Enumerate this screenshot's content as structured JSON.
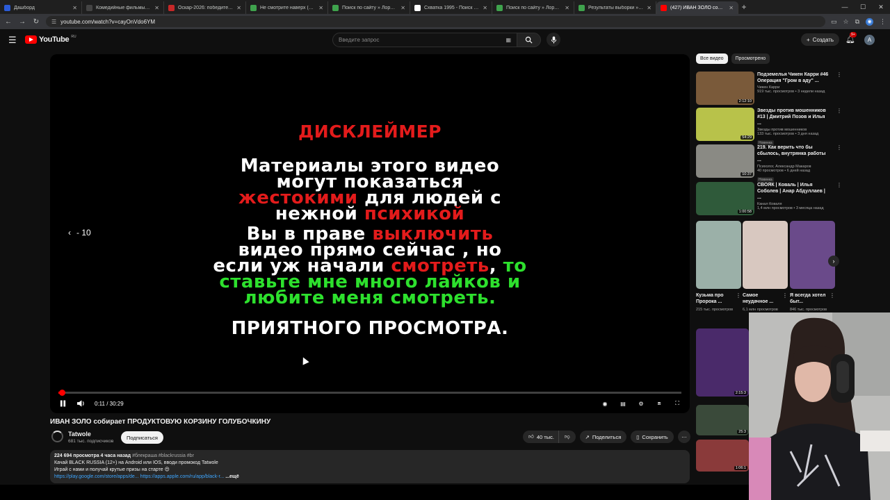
{
  "browser": {
    "tabs": [
      {
        "title": "Дашборд",
        "color": "#2b5bd7",
        "active": false
      },
      {
        "title": "Комедийные фильмы, которые...",
        "color": "#444",
        "active": false
      },
      {
        "title": "Оскар-2026: победители и но...",
        "color": "#c62828",
        "active": false
      },
      {
        "title": "Не смотрите наверх (2021) сл...",
        "color": "#3fa34d",
        "active": false
      },
      {
        "title": "Поиск по сайту » Лордфильм",
        "color": "#3fa34d",
        "active": false
      },
      {
        "title": "Схватка 1995 - Поиск в Google",
        "color": "#ffffff",
        "active": false
      },
      {
        "title": "Поиск по сайту » Лордфильм",
        "color": "#3fa34d",
        "active": false
      },
      {
        "title": "Результаты выборки » Лордф...",
        "color": "#3fa34d",
        "active": false
      },
      {
        "title": "(427) ИВАН ЗОЛО собир...",
        "color": "#ff0000",
        "active": true
      }
    ],
    "new_tab": "+",
    "url": "youtube.com/watch?v=cayOnVdo6YM"
  },
  "masthead": {
    "logo": "YouTube",
    "region": "RU",
    "search_placeholder": "Введите запрос",
    "create_label": "Создать",
    "notifications_badge": "9+",
    "avatar_letter": "A"
  },
  "video": {
    "disclaimer": {
      "heading": "ДИСКЛЕЙМЕР",
      "line1": "Материалы этого видео",
      "line2": "могут показаться",
      "line3_red": "жестокими",
      "line3_white": " для людей с",
      "line4_white": "нежной ",
      "line4_red": "психикой",
      "line5_white": "Вы в праве ",
      "line5_red": "выключить",
      "line6": "видео прямо сейчас , но",
      "line7_white": "если уж начали ",
      "line7_red": "смотреть",
      "line7_white2": ",",
      "line7_green": " то",
      "line8": "ставьте мне много лайков и",
      "line9": "любите меня смотреть.",
      "line10": "ПРИЯТНОГО ПРОСМОТРА."
    },
    "seek_back": "- 10",
    "time": "0:11 / 30:29",
    "progress_fraction": 0.006,
    "title": "ИВАН ЗОЛО собирает ПРОДУКТОВУЮ КОРЗИНУ ГОЛУБОЧКИНУ",
    "channel": {
      "name": "Tatwole",
      "subs": "681 тыс. подписчиков",
      "subscribe": "Подписаться"
    },
    "actions": {
      "likes": "40 тыс.",
      "share": "Поделиться",
      "save": "Сохранить"
    },
    "description": {
      "meta": "224 694 просмотра  4 часа назад",
      "tags": "#блекраша #blackrussia #br",
      "line1": "Качай BLACK RUSSIA (12+) на Android или IOS, вводи промокод Tatwole",
      "line2": "Играй с нами и получай крутые призы на старте 😍",
      "link1": "https://play.google.com/store/apps/de...",
      "link2": "https://apps.apple.com/ru/app/black-r...",
      "more": "...ещё"
    }
  },
  "sidebar": {
    "chips": [
      "Все видео",
      "Просмотрено"
    ],
    "recommendations": [
      {
        "title": "Подземелья Чикен Карри #46 Операция \"Гром в аду\" ...",
        "channel": "Чикен Карри",
        "meta": "919 тыс. просмотров • 3 недели назад",
        "duration": "2:12:10",
        "badge": "",
        "color": "#7a5a3a"
      },
      {
        "title": "Звезды против мошенников #13 | Дмитрий Позов и Илья ...",
        "channel": "Звезды против мошенников",
        "meta": "133 тыс. просмотров • 3 дня назад",
        "duration": "54:29",
        "badge": "Новинка",
        "color": "#b8c24a"
      },
      {
        "title": "219. Как верить что бы сбылось, внутрянка работы ...",
        "channel": "Психолог, Александр Макаров",
        "meta": "40 просмотров • 6 дней назад",
        "duration": "10:37",
        "badge": "Новинка",
        "color": "#8a8a84"
      },
      {
        "title": "СВОЯК | Коваль | Илья Соболев | Анар Абдуллаев | ...",
        "channel": "Канал Коваля",
        "meta": "1,4 млн просмотров • 3 месяца назад",
        "duration": "1:00:58",
        "badge": "",
        "color": "#2f5a3a"
      }
    ],
    "shorts": [
      {
        "title": "Кузьма про Пророка ...",
        "views": "215 тыс. просмотров",
        "color": "#9bb0a8"
      },
      {
        "title": "Самое неудачное ...",
        "views": "6,1 млн просмотров",
        "color": "#d8c8c0"
      },
      {
        "title": "Я всегда хотел быт...",
        "views": "846 тыс. просмотров",
        "color": "#6a4a8a"
      }
    ],
    "more_recs": [
      {
        "duration": "2:15:3",
        "color": "#4a2a6a"
      },
      {
        "duration": "25:3",
        "color": "#3a4a3a"
      },
      {
        "duration": "1:06:1",
        "color": "#8a3a3a"
      }
    ]
  }
}
